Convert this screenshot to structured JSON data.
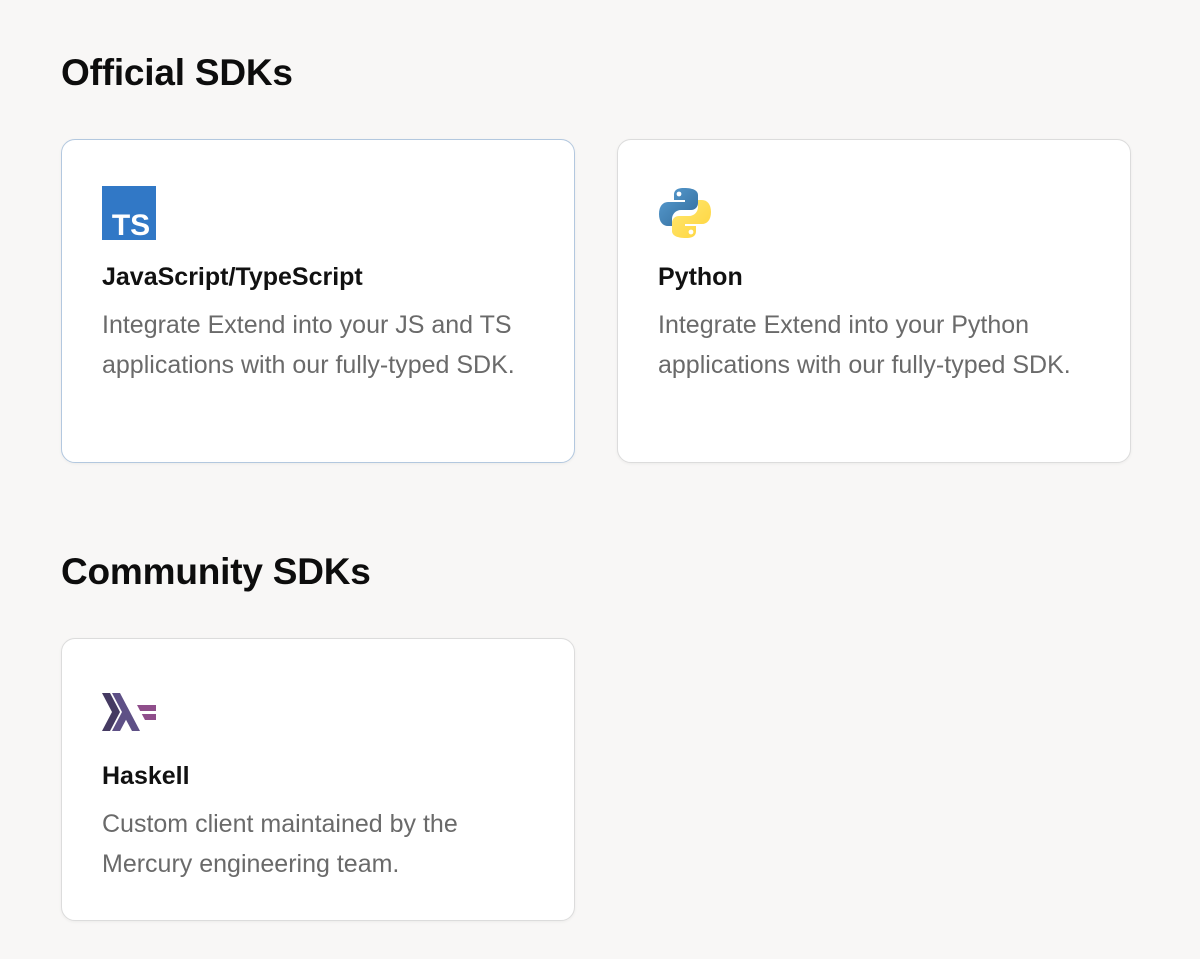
{
  "official": {
    "heading": "Official SDKs",
    "cards": [
      {
        "title": "JavaScript/TypeScript",
        "description": "Integrate Extend into your JS and TS applications with our fully-typed SDK.",
        "icon": "typescript-logo-icon",
        "logo_text": "TS",
        "accent": "#3178c6"
      },
      {
        "title": "Python",
        "description": "Integrate Extend into your Python applications with our fully-typed SDK.",
        "icon": "python-logo-icon",
        "accent": "#3776ab"
      }
    ]
  },
  "community": {
    "heading": "Community SDKs",
    "cards": [
      {
        "title": "Haskell",
        "description": "Custom client maintained by the Mercury engineering team.",
        "icon": "haskell-logo-icon",
        "accent": "#5e5086"
      }
    ]
  }
}
